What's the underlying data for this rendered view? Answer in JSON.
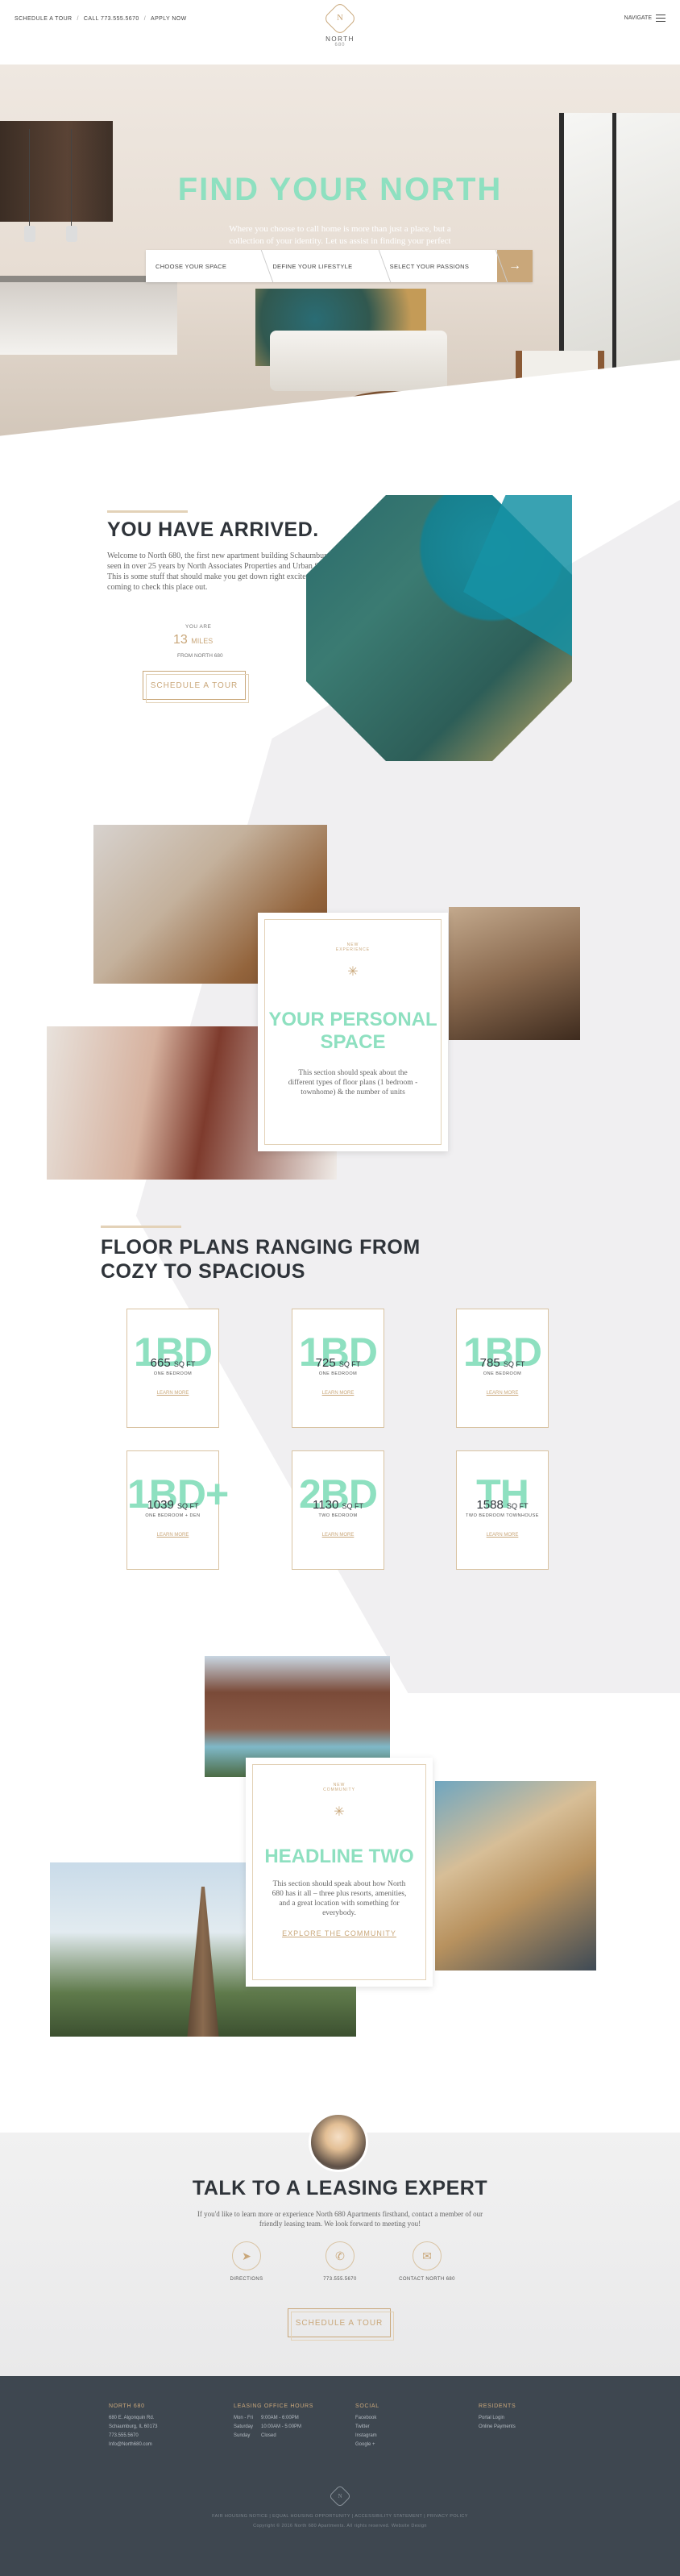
{
  "topbar": {
    "links": [
      "SCHEDULE A TOUR",
      "CALL 773.555.5670",
      "APPLY NOW"
    ],
    "logo_mark": "N",
    "logo_name": "NORTH",
    "logo_num": "680",
    "navigate": "NAVIGATE"
  },
  "hero": {
    "title": "FIND YOUR NORTH",
    "subtitle": "Where you choose to call home is more than just a place, but a collection of your identity. Let us assist in finding your perfect North 680 apartment.",
    "selectors": [
      "CHOOSE YOUR SPACE",
      "DEFINE YOUR LIFESTYLE",
      "SELECT YOUR PASSIONS"
    ],
    "go_icon": "arrow-right-icon"
  },
  "arrived": {
    "title": "YOU HAVE ARRIVED.",
    "body": "Welcome to North 680, the first new apartment building Schaumburg has seen in over 25 years by North Associates Properties and Urban Sites. This is some stuff that should make you get down right excited about coming to check this place out.",
    "miles_you": "YOU ARE",
    "miles_value": "13",
    "miles_unit": "MILES",
    "miles_from": "FROM NORTH 680",
    "button": "SCHEDULE A TOUR"
  },
  "personal": {
    "emblem_text": "NEW EXPERIENCE",
    "title": "YOUR PERSONAL SPACE",
    "body": "This section should speak about the different types of floor plans (1 bedroom - townhome) & the number of units"
  },
  "floorplans": {
    "title_line1": "FLOOR PLANS RANGING FROM",
    "title_line2": "COZY TO SPACIOUS",
    "sqft_unit": "SQ FT",
    "learn": "LEARN MORE",
    "plans": [
      {
        "code": "1BD",
        "sqft": "665",
        "type": "ONE BEDROOM"
      },
      {
        "code": "1BD",
        "sqft": "725",
        "type": "ONE BEDROOM"
      },
      {
        "code": "1BD",
        "sqft": "785",
        "type": "ONE BEDROOM"
      },
      {
        "code": "1BD+",
        "sqft": "1039",
        "type": "ONE BEDROOM + DEN"
      },
      {
        "code": "2BD",
        "sqft": "1130",
        "type": "TWO BEDROOM"
      },
      {
        "code": "TH",
        "sqft": "1588",
        "type": "TWO BEDROOM TOWNHOUSE"
      }
    ]
  },
  "headline_two": {
    "emblem_text": "NEW COMMUNITY",
    "title": "HEADLINE TWO",
    "body": "This section should speak about how North 680 has it all – three plus resorts, amenities, and a great location with something for everybody.",
    "link": "EXPLORE THE COMMUNITY"
  },
  "leasing": {
    "title": "TALK TO A LEASING EXPERT",
    "body": "If you'd like to learn more or experience North 680 Apartments firsthand, contact a member of our friendly leasing team. We look forward to meeting you!",
    "contacts": [
      {
        "icon": "directions-icon",
        "glyph": "➤",
        "label": "DIRECTIONS"
      },
      {
        "icon": "phone-icon",
        "glyph": "✆",
        "label": "773.555.5670"
      },
      {
        "icon": "mail-icon",
        "glyph": "✉",
        "label": "CONTACT NORTH 680"
      }
    ],
    "button": "SCHEDULE A TOUR"
  },
  "footer": {
    "col1_title": "NORTH 680",
    "col1_lines": [
      "680 E. Algonquin Rd.",
      "Schaumburg, IL 60173",
      "773.555.5670",
      "Info@North680.com"
    ],
    "col2_title": "LEASING OFFICE HOURS",
    "hours": [
      [
        "Mon - Fri",
        "9:00AM - 6:00PM"
      ],
      [
        "Saturday",
        "10:00AM - 5:00PM"
      ],
      [
        "Sunday",
        "Closed"
      ]
    ],
    "col3_title": "SOCIAL",
    "col3_lines": [
      "Facebook",
      "Twitter",
      "Instagram",
      "Google +"
    ],
    "col4_title": "RESIDENTS",
    "col4_lines": [
      "Portal Login",
      "Online Payments"
    ],
    "logo_mark": "N",
    "bottom1": "FAIR HOUSING NOTICE   |   EQUAL HOUSING OPPORTUNITY   |   ACCESSIBILITY STATEMENT   |   PRIVACY POLICY",
    "bottom2": "Copyright © 2016 North 680 Apartments. All rights reserved.   Website Design"
  },
  "colors": {
    "mint": "#8ee0c0",
    "gold": "#c9a77a",
    "footer": "#3e4750"
  }
}
